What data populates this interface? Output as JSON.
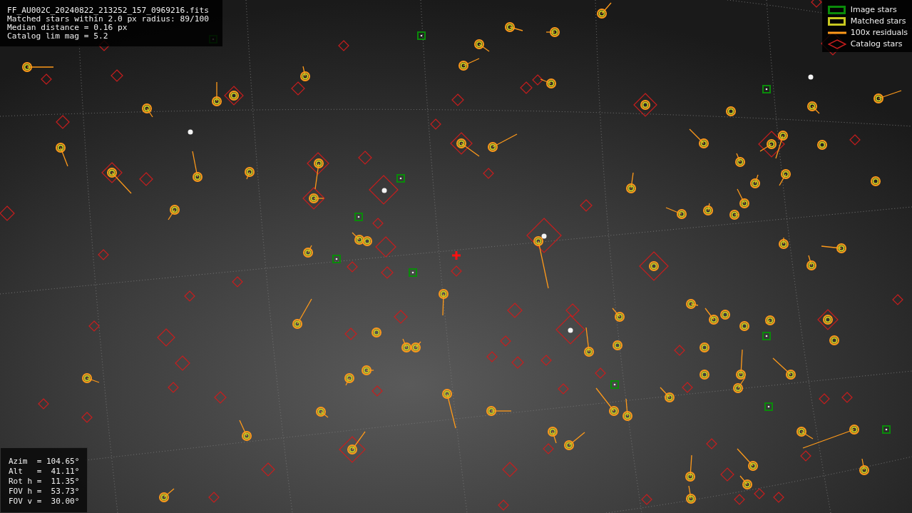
{
  "info_box": {
    "lines": [
      "FF_AU002C_20240822_213252_157_0969216.fits",
      "Matched stars within 2.0 px radius: 89/100",
      "Median distance = 0.16 px",
      "Catalog lim mag = 5.2"
    ]
  },
  "legend": [
    {
      "kind": "image",
      "label": "Image stars",
      "color": "#0a8a0a"
    },
    {
      "kind": "matched",
      "label": "Matched stars",
      "color": "#c8c820"
    },
    {
      "kind": "residual",
      "label": "100x residuals",
      "color": "#ff9a1a"
    },
    {
      "kind": "catalog",
      "label": "Catalog stars",
      "color": "#c81e1e"
    }
  ],
  "pointing": {
    "lines": [
      "Azim  = 104.65°",
      "Alt   =  41.11°",
      "Rot h =  11.35°",
      "FOV h =  53.73°",
      "FOV v =  30.00°"
    ]
  }
}
